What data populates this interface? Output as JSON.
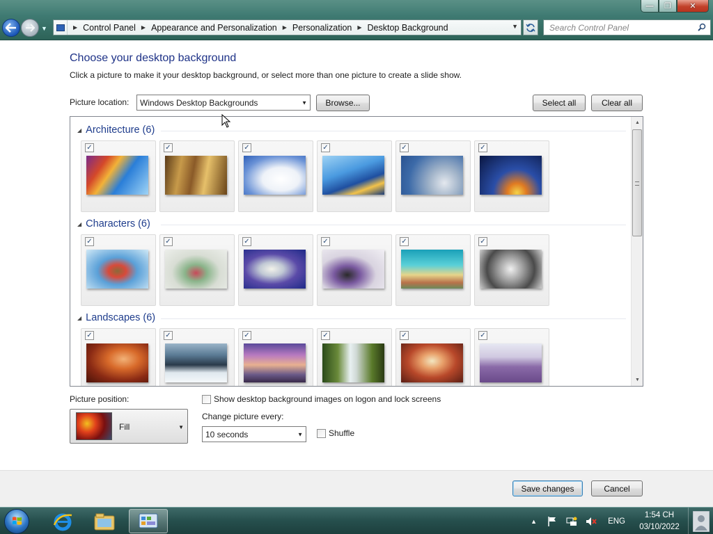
{
  "window": {
    "controls": {
      "minimize": "—",
      "maximize": "❐",
      "close": "✕"
    }
  },
  "address_bar": {
    "breadcrumbs": [
      "Control Panel",
      "Appearance and Personalization",
      "Personalization",
      "Desktop Background"
    ],
    "search_placeholder": "Search Control Panel"
  },
  "page": {
    "title": "Choose your desktop background",
    "subtitle": "Click a picture to make it your desktop background, or select more than one picture to create a slide show.",
    "picture_location_label": "Picture location:",
    "picture_location_value": "Windows Desktop Backgrounds",
    "browse_label": "Browse...",
    "select_all_label": "Select all",
    "clear_all_label": "Clear all"
  },
  "gallery": {
    "groups": [
      {
        "name": "Architecture (6)",
        "images_checked": [
          true,
          true,
          true,
          true,
          true,
          true
        ]
      },
      {
        "name": "Characters (6)",
        "images_checked": [
          true,
          true,
          true,
          true,
          true,
          true
        ]
      },
      {
        "name": "Landscapes (6)",
        "images_checked": [
          true,
          true,
          true,
          true,
          true,
          true
        ]
      }
    ]
  },
  "options": {
    "picture_position_label": "Picture position:",
    "picture_position_value": "Fill",
    "show_on_logon_label": "Show desktop background images on logon and lock screens",
    "show_on_logon_checked": false,
    "change_every_label": "Change picture every:",
    "change_every_value": "10 seconds",
    "shuffle_label": "Shuffle",
    "shuffle_checked": false
  },
  "footer": {
    "save_label": "Save changes",
    "cancel_label": "Cancel"
  },
  "taskbar": {
    "language": "ENG",
    "time": "1:54 CH",
    "date": "03/10/2022",
    "pinned": [
      "internet-explorer",
      "windows-explorer",
      "control-panel"
    ]
  },
  "colors": {
    "title_blue": "#1e3287",
    "group_blue": "#1e3c8c",
    "chrome_teal": "#3f7a72"
  }
}
